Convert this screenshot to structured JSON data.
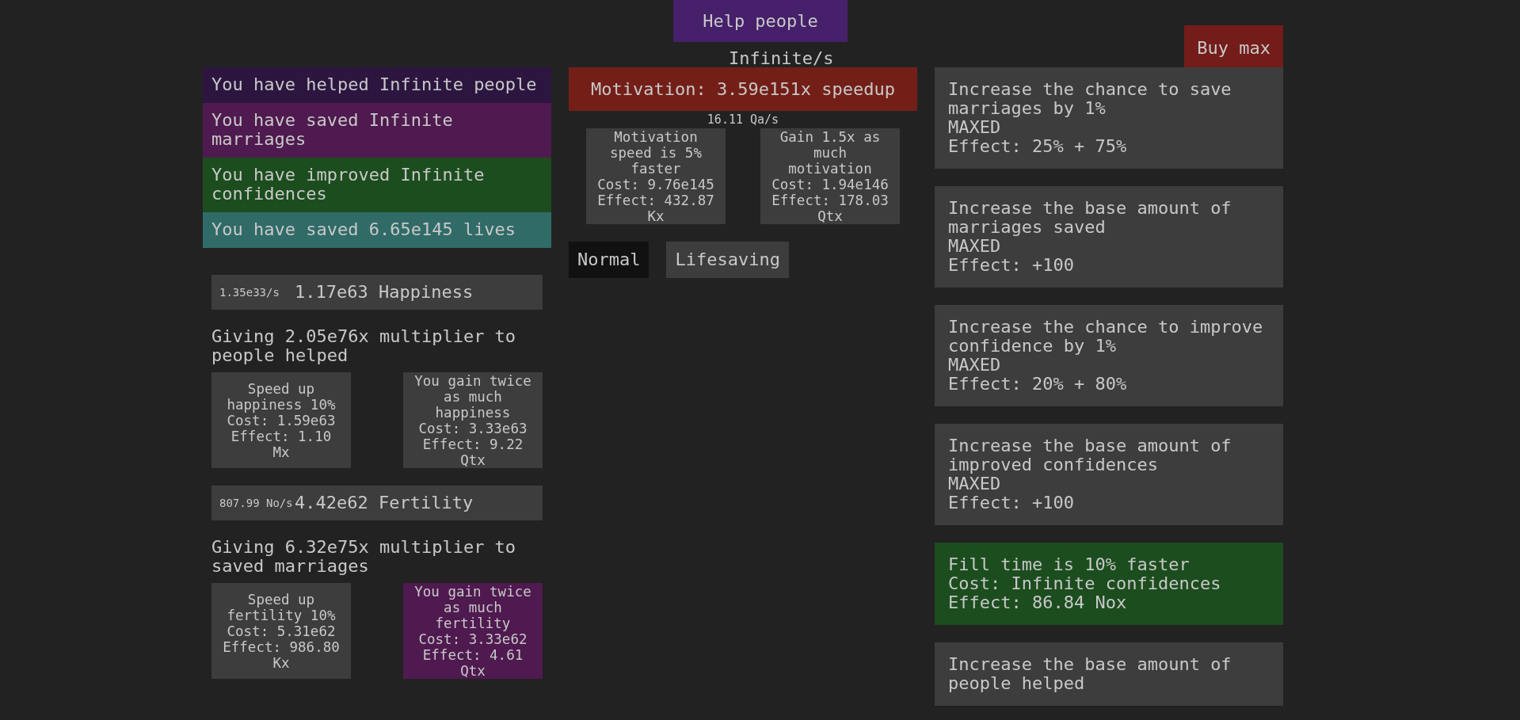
{
  "header": {
    "help_button": "Help people",
    "rate": "Infinite/s",
    "buy_max_button": "Buy max"
  },
  "stats": [
    {
      "text": "You have helped Infinite people",
      "color": "#2c1640"
    },
    {
      "text": "You have saved Infinite marriages",
      "color": "#4f1a4f"
    },
    {
      "text": "You have improved Infinite confidences",
      "color": "#1c4d1e"
    },
    {
      "text": "You have saved 6.65e145 lives",
      "color": "#306b68"
    }
  ],
  "resources": [
    {
      "rate": "1.35e33/s",
      "amount": "1.17e63 Happiness",
      "multiplier": "Giving 2.05e76x multiplier to people helped",
      "upgrades": [
        {
          "description": "Speed up happiness 10%",
          "cost": "Cost: 1.59e63",
          "effect": "Effect: 1.10 Mx",
          "highlighted": false
        },
        {
          "description": "You gain twice as much happiness",
          "cost": "Cost: 3.33e63",
          "effect": "Effect: 9.22 Qtx",
          "highlighted": false
        }
      ]
    },
    {
      "rate": "807.99 No/s",
      "amount": "4.42e62 Fertility",
      "multiplier": "Giving 6.32e75x multiplier to saved marriages",
      "upgrades": [
        {
          "description": "Speed up fertility 10%",
          "cost": "Cost: 5.31e62",
          "effect": "Effect: 986.80 Kx",
          "highlighted": false
        },
        {
          "description": "You gain twice as much fertility",
          "cost": "Cost: 3.33e62",
          "effect": "Effect: 4.61 Qtx",
          "highlighted": true
        }
      ]
    }
  ],
  "motivation": {
    "label": "Motivation: 3.59e151x speedup",
    "rate": "16.11 Qa/s",
    "upgrades": [
      {
        "description": "Motivation speed is 5% faster",
        "cost": "Cost: 9.76e145",
        "effect": "Effect: 432.87 Kx",
        "highlighted": false
      },
      {
        "description": "Gain 1.5x as much motivation",
        "cost": "Cost: 1.94e146",
        "effect": "Effect: 178.03 Qtx",
        "highlighted": false
      }
    ]
  },
  "modes": [
    {
      "label": "Normal",
      "selected": true
    },
    {
      "label": "Lifesaving",
      "selected": false
    }
  ],
  "upgrades": [
    {
      "description": "Increase the chance to save marriages by 1%",
      "status": "MAXED",
      "effect": "Effect: 25% + 75%",
      "highlighted": false
    },
    {
      "description": "Increase the base amount of marriages saved",
      "status": "MAXED",
      "effect": "Effect: +100",
      "highlighted": false
    },
    {
      "description": "Increase the chance to improve confidence by 1%",
      "status": "MAXED",
      "effect": "Effect: 20% + 80%",
      "highlighted": false
    },
    {
      "description": "Increase the base amount of improved confidences",
      "status": "MAXED",
      "effect": "Effect: +100",
      "highlighted": false
    },
    {
      "description": "Fill time is 10% faster",
      "status": "Cost: Infinite confidences",
      "effect": "Effect: 86.84 Nox",
      "highlighted": true
    },
    {
      "description": "Increase the base amount of people helped",
      "highlighted": false
    }
  ]
}
